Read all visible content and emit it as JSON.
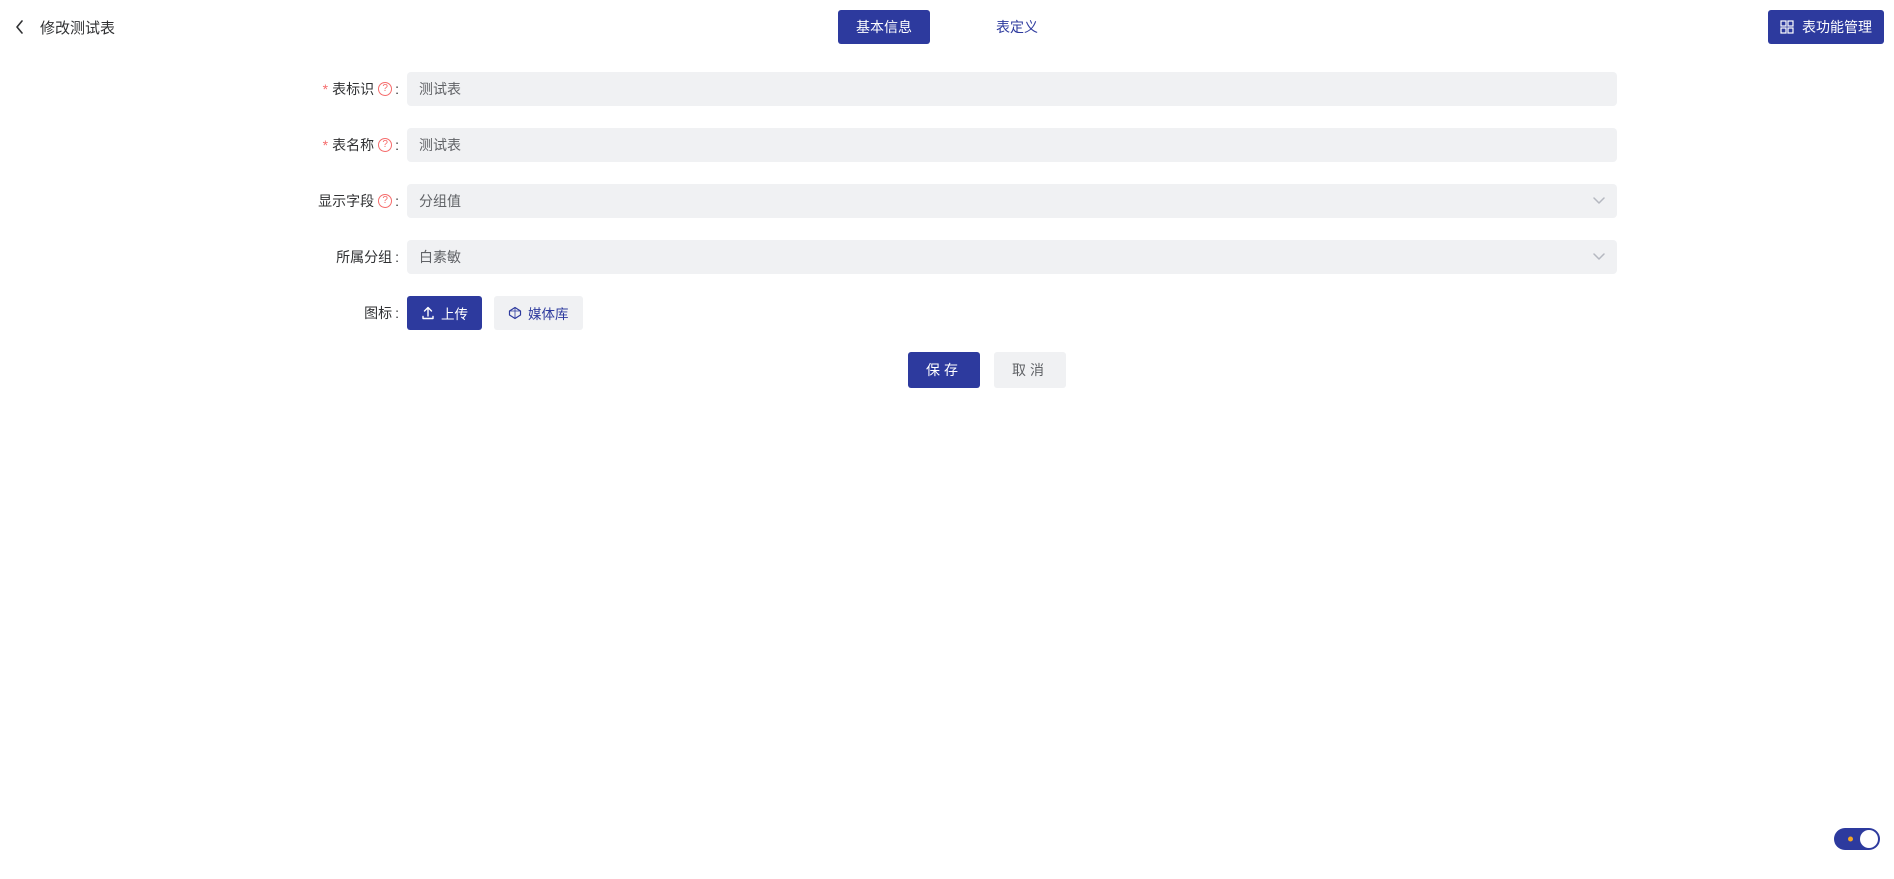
{
  "header": {
    "title": "修改测试表",
    "tabs": {
      "basic": "基本信息",
      "definition": "表定义"
    },
    "manage_btn": "表功能管理"
  },
  "form": {
    "table_id": {
      "label": "表标识",
      "value": "测试表"
    },
    "table_name": {
      "label": "表名称",
      "value": "测试表"
    },
    "display_field": {
      "label": "显示字段",
      "value": "分组值"
    },
    "group": {
      "label": "所属分组",
      "value": "白素敏"
    },
    "icon": {
      "label": "图标",
      "upload_btn": "上传",
      "media_btn": "媒体库"
    }
  },
  "actions": {
    "save": "保存",
    "cancel": "取消"
  },
  "toggle": {
    "state": "on"
  }
}
